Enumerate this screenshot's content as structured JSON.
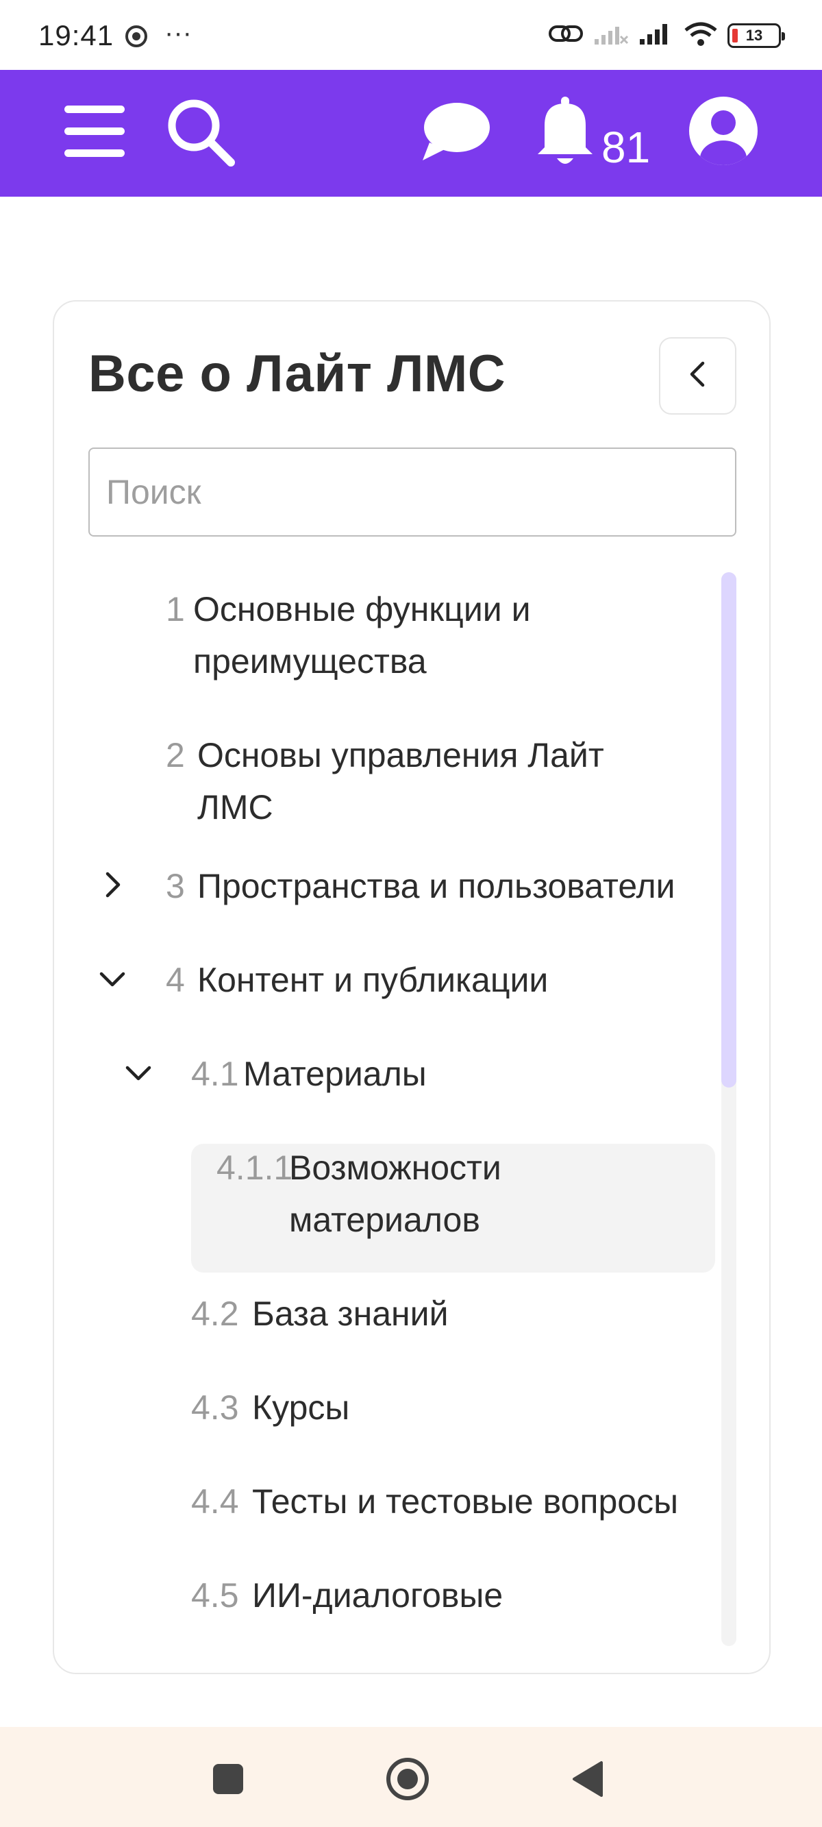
{
  "status_bar": {
    "time": "19:41",
    "more_dots": "···",
    "battery_level": "13",
    "icons": [
      "chrome-icon",
      "link-icon",
      "no-signal-icon",
      "signal-icon",
      "wifi-icon",
      "battery-icon"
    ]
  },
  "app_bar": {
    "background": "#7c3aed",
    "notification_count": "81",
    "icons": [
      "menu-icon",
      "search-icon",
      "chat-icon",
      "bell-icon",
      "user-icon"
    ]
  },
  "card": {
    "title": "Все о Лайт ЛМС",
    "search_placeholder": "Поиск",
    "collapse_icon": "chevron-left-icon"
  },
  "toc": [
    {
      "num": "1",
      "lines": [
        "Основные функции и",
        "преимущества"
      ],
      "chevron": "none"
    },
    {
      "num": "2",
      "lines": [
        "Основы управления Лайт",
        "ЛМС"
      ],
      "chevron": "none"
    },
    {
      "num": "3",
      "lines": [
        "Пространства и пользователи"
      ],
      "chevron": "chevron-right-icon"
    },
    {
      "num": "4",
      "lines": [
        "Контент и публикации"
      ],
      "chevron": "chevron-down-icon"
    },
    {
      "num": "4.1",
      "lines": [
        "Материалы"
      ],
      "chevron": "chevron-down-icon"
    },
    {
      "num": "4.1.1",
      "lines": [
        "Возможности",
        "материалов"
      ],
      "chevron": "none",
      "active": true
    },
    {
      "num": "4.2",
      "lines": [
        "База знаний"
      ],
      "chevron": "none"
    },
    {
      "num": "4.3",
      "lines": [
        "Курсы"
      ],
      "chevron": "none"
    },
    {
      "num": "4.4",
      "lines": [
        "Тесты и тестовые вопросы"
      ],
      "chevron": "none"
    },
    {
      "num": "4.5",
      "lines": [
        "ИИ-диалоговые"
      ],
      "chevron": "none"
    }
  ],
  "nav_bar": {
    "icons": [
      "recents-square-icon",
      "home-circle-icon",
      "back-triangle-icon"
    ]
  }
}
